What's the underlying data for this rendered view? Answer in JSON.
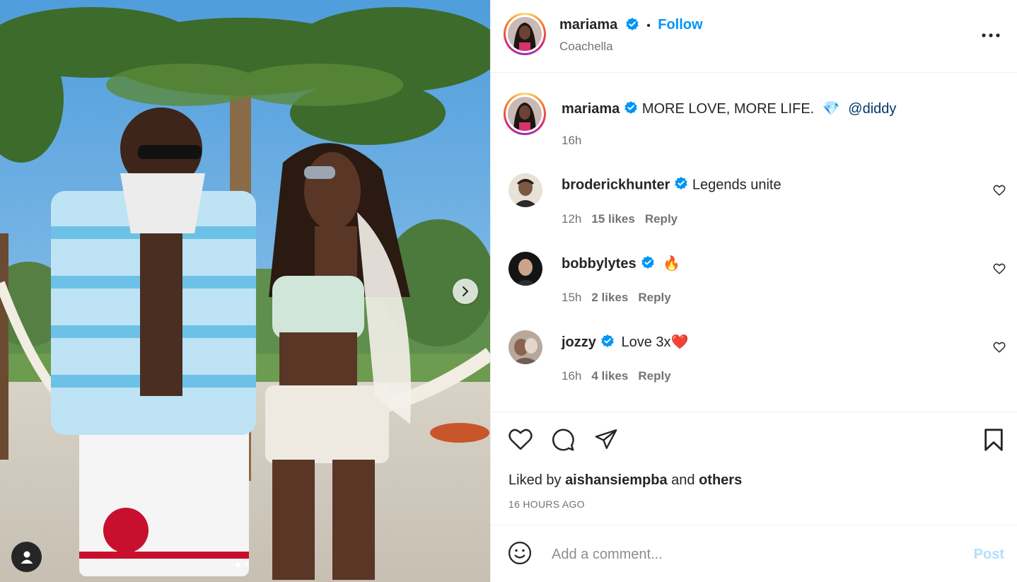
{
  "header": {
    "username": "mariama",
    "separator": "•",
    "follow_label": "Follow",
    "location": "Coachella",
    "more_icon": "more-horizontal-icon"
  },
  "caption": {
    "username": "mariama",
    "text": "MORE LOVE, MORE LIFE.",
    "emoji": "💎",
    "mention": "@diddy",
    "time": "16h"
  },
  "comments": [
    {
      "username": "broderickhunter",
      "text": "Legends unite",
      "time": "12h",
      "likes": "15 likes",
      "reply": "Reply"
    },
    {
      "username": "bobbylytes",
      "text": "🔥",
      "time": "15h",
      "likes": "2 likes",
      "reply": "Reply"
    },
    {
      "username": "jozzy",
      "text": "Love 3x❤️",
      "time": "16h",
      "likes": "4 likes",
      "reply": "Reply"
    }
  ],
  "actions": {
    "liked_prefix": "Liked by",
    "liked_user": "aishansiempba",
    "liked_and": "and",
    "liked_others": "others",
    "timestamp": "16 HOURS AGO"
  },
  "add_comment": {
    "placeholder": "Add a comment...",
    "post_label": "Post"
  },
  "carousel": {
    "slides": 2,
    "active": 1
  },
  "colors": {
    "link_blue": "#0095f6",
    "verified_blue": "#0095f6",
    "muted": "#737373",
    "post_disabled": "#b2dffc"
  }
}
